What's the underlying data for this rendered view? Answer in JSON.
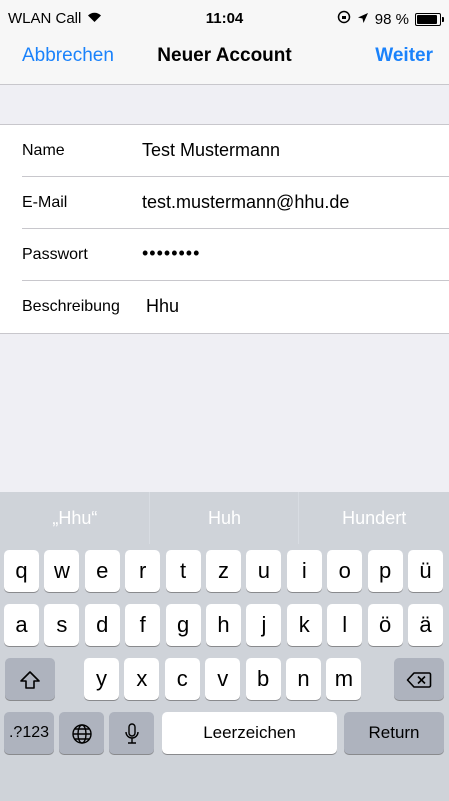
{
  "status": {
    "carrier": "WLAN Call",
    "time": "11:04",
    "battery": "98 %",
    "battery_level": 0.98
  },
  "nav": {
    "cancel": "Abbrechen",
    "title": "Neuer Account",
    "next": "Weiter"
  },
  "form": {
    "name_label": "Name",
    "name_value": "Test Mustermann",
    "email_label": "E-Mail",
    "email_value": "test.mustermann@hhu.de",
    "password_label": "Passwort",
    "password_value": "••••••••",
    "description_label": "Beschreibung",
    "description_value": "Hhu"
  },
  "keyboard": {
    "suggestions": [
      "„Hhu“",
      "Huh",
      "Hundert"
    ],
    "row1": [
      "q",
      "w",
      "e",
      "r",
      "t",
      "z",
      "u",
      "i",
      "o",
      "p",
      "ü"
    ],
    "row2": [
      "a",
      "s",
      "d",
      "f",
      "g",
      "h",
      "j",
      "k",
      "l",
      "ö",
      "ä"
    ],
    "row3": [
      "y",
      "x",
      "c",
      "v",
      "b",
      "n",
      "m"
    ],
    "numbers_key": ".?123",
    "space_key": "Leerzeichen",
    "return_key": "Return"
  }
}
